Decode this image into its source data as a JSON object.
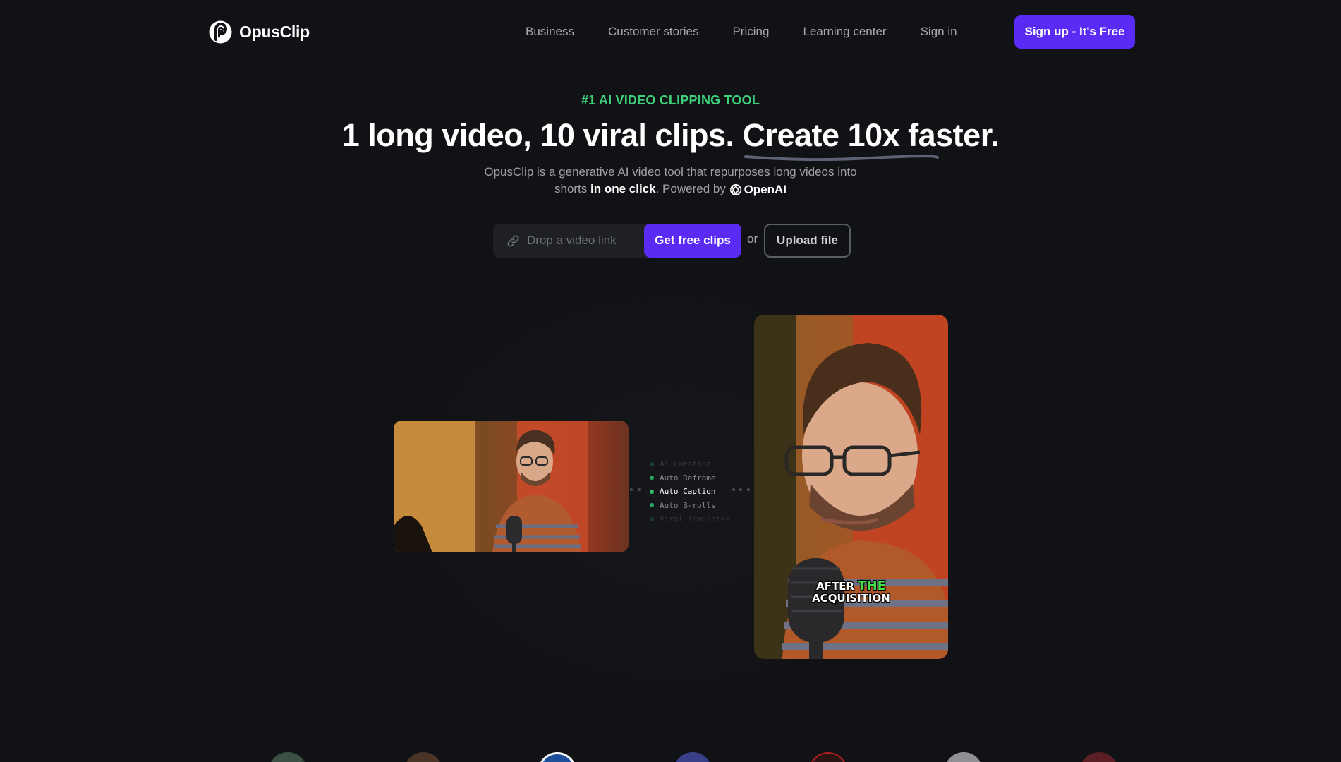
{
  "brand": {
    "name": "OpusClip",
    "accent": "#5a2bf5",
    "green": "#3ed07a"
  },
  "nav": {
    "links": [
      "Business",
      "Customer stories",
      "Pricing",
      "Learning center"
    ],
    "signin": "Sign in",
    "signup": "Sign up - It's Free"
  },
  "hero": {
    "eyebrow": "#1 AI VIDEO CLIPPING TOOL",
    "headline_a": "1 long video, 10 viral clips. ",
    "headline_b": "Create 10x faster.",
    "subtitle_a": "OpusClip is a generative AI video tool that repurposes long videos into",
    "subtitle_b": "shorts ",
    "subtitle_strong": "in one click",
    "subtitle_c": ". Powered by ",
    "powered_by": "OpenAI"
  },
  "input": {
    "placeholder": "Drop a video link",
    "value": "",
    "submit": "Get free clips",
    "or": "or",
    "upload": "Upload file"
  },
  "demo": {
    "features": [
      "AI Curation",
      "Auto Reframe",
      "Auto Caption",
      "Auto B-rolls",
      "Viral Templates"
    ],
    "active_feature": "Auto Caption",
    "caption_a": "AFTER ",
    "caption_highlight": "THE",
    "caption_b": "ACQUISITION"
  },
  "icons": {
    "logo": "opusclip-logo-icon",
    "link": "link-icon",
    "openai": "openai-logo-icon"
  }
}
